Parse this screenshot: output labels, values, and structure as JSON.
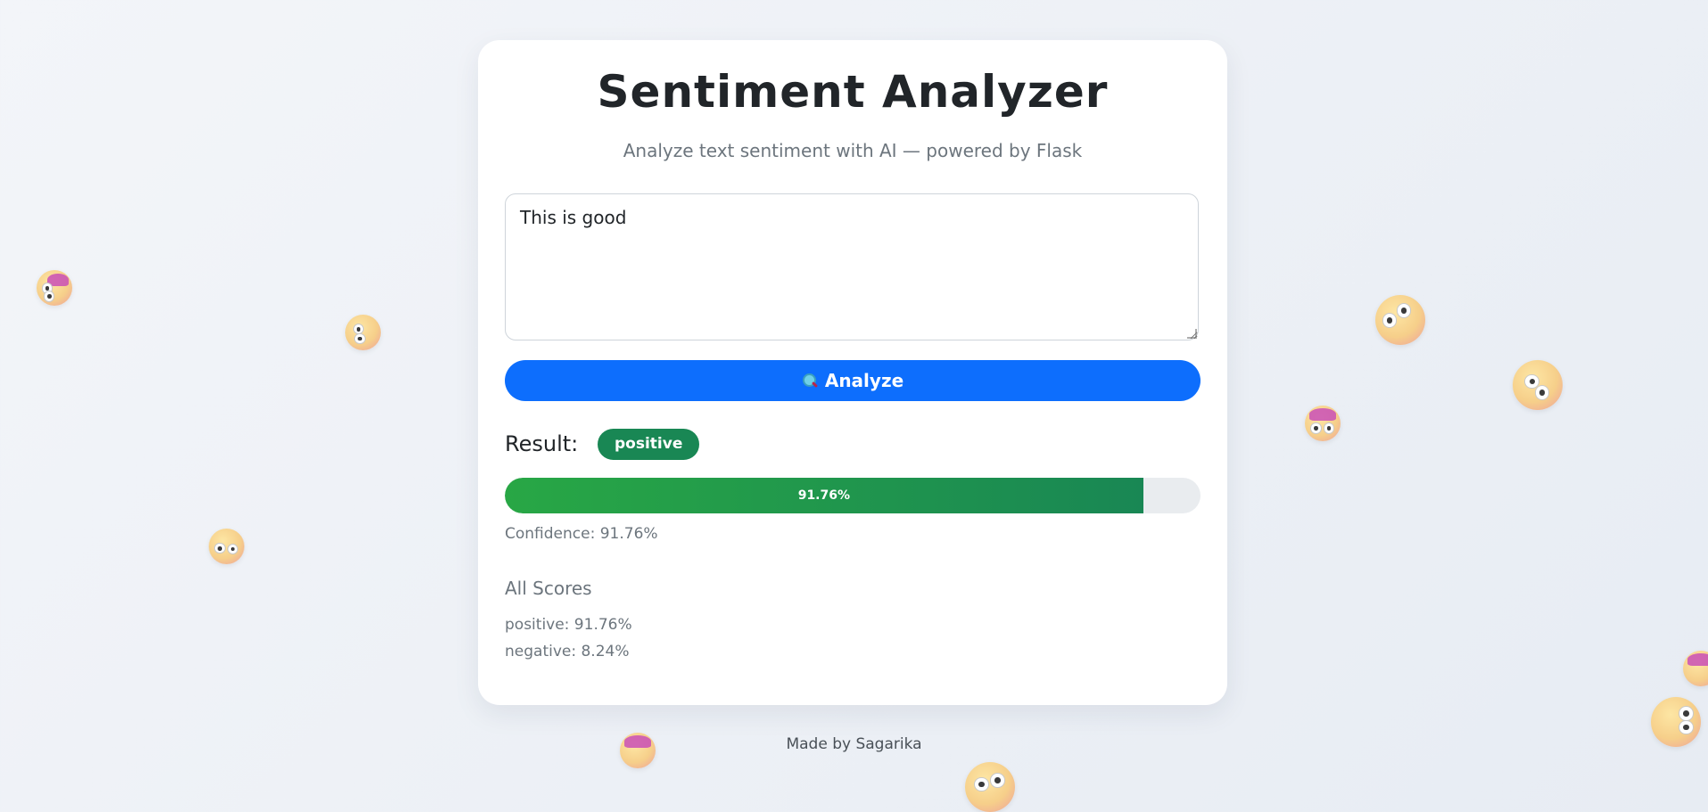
{
  "header": {
    "title": "Sentiment Analyzer",
    "subtitle": "Analyze text sentiment with AI — powered by Flask"
  },
  "input": {
    "value": "This is good"
  },
  "analyze_button": {
    "label": "Analyze",
    "icon": "magnifier-icon"
  },
  "result": {
    "label": "Result:",
    "sentiment": "positive",
    "confidence_value": 0.9176,
    "confidence_text": "91.76%",
    "confidence_label": "Confidence: 91.76%"
  },
  "scores": {
    "heading": "All Scores",
    "items": [
      "positive: 91.76%",
      "negative: 8.24%"
    ]
  },
  "footer": {
    "text": "Made by Sagarika"
  },
  "colors": {
    "primary": "#0d6efd",
    "success": "#198754",
    "muted": "#6c757d"
  }
}
